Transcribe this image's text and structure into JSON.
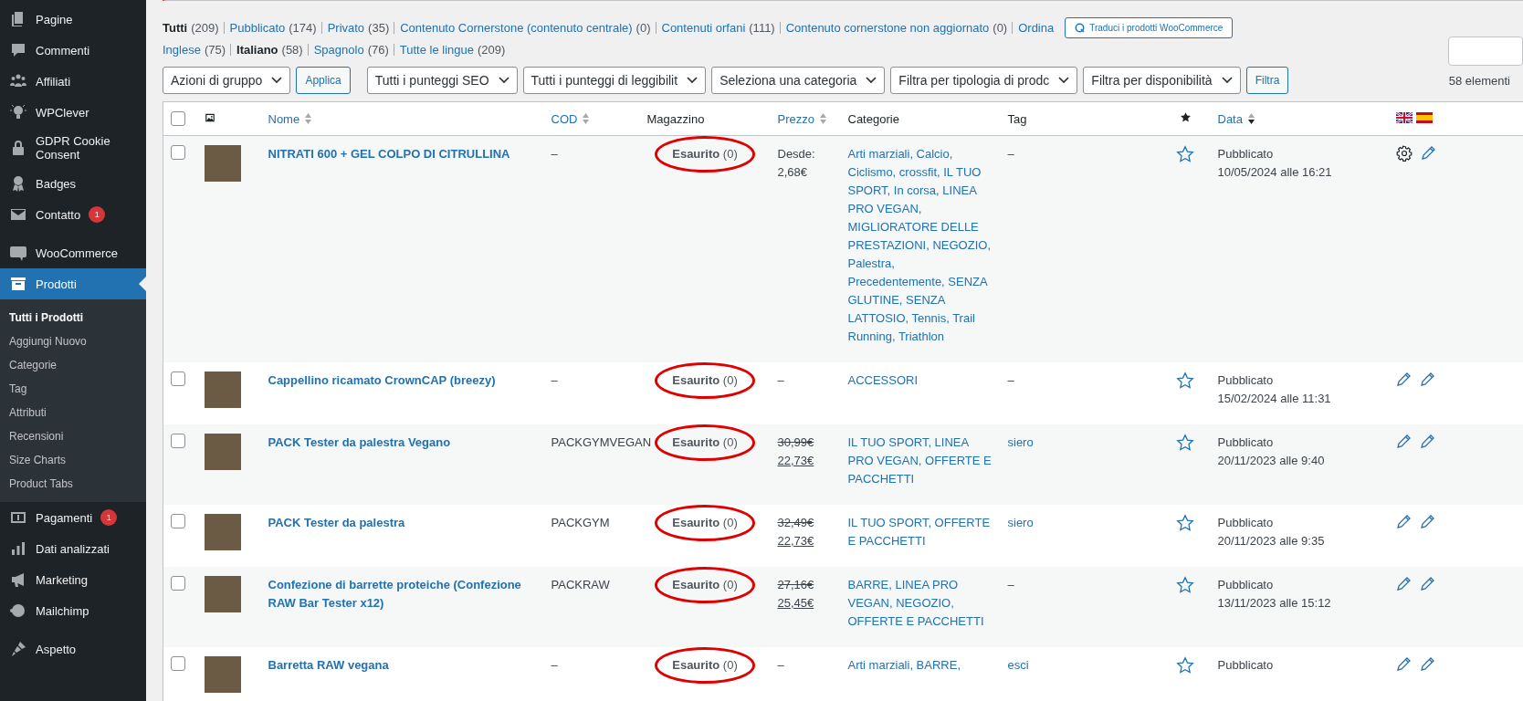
{
  "sidebar": {
    "items": [
      {
        "label": "Pagine",
        "selected": false
      },
      {
        "label": "Commenti",
        "selected": false
      },
      {
        "label": "Affiliati",
        "selected": false
      },
      {
        "label": "WPClever",
        "selected": false
      },
      {
        "label": "GDPR Cookie Consent",
        "selected": false
      },
      {
        "label": "Badges",
        "selected": false
      },
      {
        "label": "Contatto",
        "selected": false,
        "badge": "1"
      },
      {
        "label": "WooCommerce",
        "selected": false
      },
      {
        "label": "Prodotti",
        "selected": true,
        "children": [
          {
            "label": "Tutti i Prodotti",
            "selected": true
          },
          {
            "label": "Aggiungi Nuovo",
            "selected": false
          },
          {
            "label": "Categorie",
            "selected": false
          },
          {
            "label": "Tag",
            "selected": false
          },
          {
            "label": "Attributi",
            "selected": false
          },
          {
            "label": "Recensioni",
            "selected": false
          },
          {
            "label": "Size Charts",
            "selected": false
          },
          {
            "label": "Product Tabs",
            "selected": false
          }
        ]
      },
      {
        "label": "Pagamenti",
        "selected": false,
        "badge": "1"
      },
      {
        "label": "Dati analizzati",
        "selected": false
      },
      {
        "label": "Marketing",
        "selected": false
      },
      {
        "label": "Mailchimp",
        "selected": false
      },
      {
        "label": "Aspetto",
        "selected": false
      }
    ]
  },
  "status_links": [
    {
      "label": "Tutti",
      "count": "(209)",
      "selected": true
    },
    {
      "label": "Pubblicato",
      "count": "(174)",
      "selected": false
    },
    {
      "label": "Privato",
      "count": "(35)",
      "selected": false
    },
    {
      "label": "Contenuto Cornerstone (contenuto centrale)",
      "count": "(0)",
      "selected": false
    },
    {
      "label": "Contenuti orfani",
      "count": "(111)",
      "selected": false
    },
    {
      "label": "Contenuto cornerstone non aggiornato",
      "count": "(0)",
      "selected": false
    },
    {
      "label": "Ordina",
      "selected": false
    }
  ],
  "translate_button": "Traduci i prodotti WooCommerce",
  "language_links": [
    {
      "label": "Inglese",
      "count": "(75)",
      "selected": false
    },
    {
      "label": "Italiano",
      "count": "(58)",
      "selected": true
    },
    {
      "label": "Spagnolo",
      "count": "(76)",
      "selected": false
    },
    {
      "label": "Tutte le lingue",
      "count": "(209)",
      "selected": false
    }
  ],
  "filters": [
    {
      "kind": "select",
      "text": "Azioni di gruppo"
    },
    {
      "kind": "button",
      "text": "Applica"
    },
    {
      "kind": "select",
      "text": "Tutti i punteggi SEO"
    },
    {
      "kind": "select",
      "text": "Tutti i punteggi di leggibilit"
    },
    {
      "kind": "select",
      "text": "Seleziona una categoria"
    },
    {
      "kind": "select",
      "text": "Filtra per tipologia di prodc"
    },
    {
      "kind": "select",
      "text": "Filtra per disponibilità"
    },
    {
      "kind": "button",
      "text": "Filtra"
    }
  ],
  "item_count": "58 elementi",
  "table": {
    "columns": [
      {
        "kind": "checkbox",
        "checked": false
      },
      {
        "kind": "image"
      },
      {
        "kind": "text",
        "label": "Nome",
        "sortable": true
      },
      {
        "kind": "text",
        "label": "COD",
        "sortable": true
      },
      {
        "kind": "text",
        "label": "Magazzino",
        "sortable": false
      },
      {
        "kind": "text",
        "label": "Prezzo",
        "sortable": true
      },
      {
        "kind": "text",
        "label": "Categorie",
        "sortable": false
      },
      {
        "kind": "text",
        "label": "Tag",
        "sortable": false
      },
      {
        "kind": "star"
      },
      {
        "kind": "text",
        "label": "Data",
        "sortable": true,
        "sorted_descending": true
      },
      {
        "kind": "flags"
      }
    ],
    "rows": [
      {
        "checked": false,
        "name": "NITRATI 600 + GEL COLPO DI CITRULLINA",
        "cod": "–",
        "stock": "**Esaurito** (0)",
        "circled": true,
        "price": {
          "kind": "from",
          "label": "Desde:",
          "value": "2,68€"
        },
        "categories": "Arti marziali, Calcio, Ciclismo, crossfit, IL TUO SPORT, In corsa, LINEA PRO VEGAN, MIGLIORATORE DELLE PRESTAZIONI, NEGOZIO, Palestra, Precedentemente, SENZA GLUTINE, SENZA LATTOSIO, Tennis, Trail Running, Triathlon",
        "tag": "–",
        "tag_link": false,
        "featured": false,
        "status": "Pubblicato",
        "date": "10/05/2024 alle 16:21",
        "translations": [
          {
            "kind": "settings"
          },
          {
            "kind": "edit"
          }
        ]
      },
      {
        "checked": false,
        "name": "Cappellino ricamato CrownCAP (breezy)",
        "cod": "–",
        "stock": "**Esaurito** (0)",
        "circled": true,
        "price": {
          "kind": "none",
          "value": "–"
        },
        "categories": "ACCESSORI",
        "tag": "–",
        "tag_link": false,
        "featured": false,
        "status": "Pubblicato",
        "date": "15/02/2024 alle 11:31",
        "translations": [
          {
            "kind": "edit"
          },
          {
            "kind": "edit"
          }
        ]
      },
      {
        "checked": false,
        "name": "PACK Tester da palestra Vegano",
        "cod": "PACKGYMVEGAN",
        "stock": "**Esaurito** (0)",
        "circled": true,
        "price": {
          "kind": "sale",
          "old": "30,99€",
          "value": "22,73€"
        },
        "categories": "IL TUO SPORT, LINEA PRO VEGAN, OFFERTE E PACCHETTI",
        "tag": "siero",
        "tag_link": true,
        "featured": false,
        "status": "Pubblicato",
        "date": "20/11/2023 alle 9:40",
        "translations": [
          {
            "kind": "edit"
          },
          {
            "kind": "edit"
          }
        ]
      },
      {
        "checked": false,
        "name": "PACK Tester da palestra",
        "cod": "PACKGYM",
        "stock": "**Esaurito** (0)",
        "circled": true,
        "price": {
          "kind": "sale",
          "old": "32,49€",
          "value": "22,73€"
        },
        "categories": "IL TUO SPORT, OFFERTE E PACCHETTI",
        "tag": "siero",
        "tag_link": true,
        "featured": false,
        "status": "Pubblicato",
        "date": "20/11/2023 alle 9:35",
        "translations": [
          {
            "kind": "edit"
          },
          {
            "kind": "edit"
          }
        ]
      },
      {
        "checked": false,
        "name": "Confezione di barrette proteiche (Confezione RAW Bar Tester x12)",
        "cod": "PACKRAW",
        "stock": "**Esaurito** (0)",
        "circled": true,
        "price": {
          "kind": "sale",
          "old": "27,16€",
          "value": "25,45€"
        },
        "categories": "BARRE, LINEA PRO VEGAN, NEGOZIO, OFFERTE E PACCHETTI",
        "tag": "–",
        "tag_link": false,
        "featured": false,
        "status": "Pubblicato",
        "date": "13/11/2023 alle 15:12",
        "translations": [
          {
            "kind": "edit"
          },
          {
            "kind": "edit"
          }
        ]
      },
      {
        "checked": false,
        "name": "Barretta RAW vegana",
        "cod": "–",
        "stock": "**Esaurito** (0)",
        "circled": true,
        "price": {
          "kind": "none",
          "value": "–"
        },
        "categories": "Arti marziali, BARRE,",
        "tag": "esci",
        "tag_link": true,
        "featured": false,
        "status": "Pubblicato",
        "translations": [
          {
            "kind": "edit"
          },
          {
            "kind": "edit"
          }
        ]
      }
    ]
  }
}
